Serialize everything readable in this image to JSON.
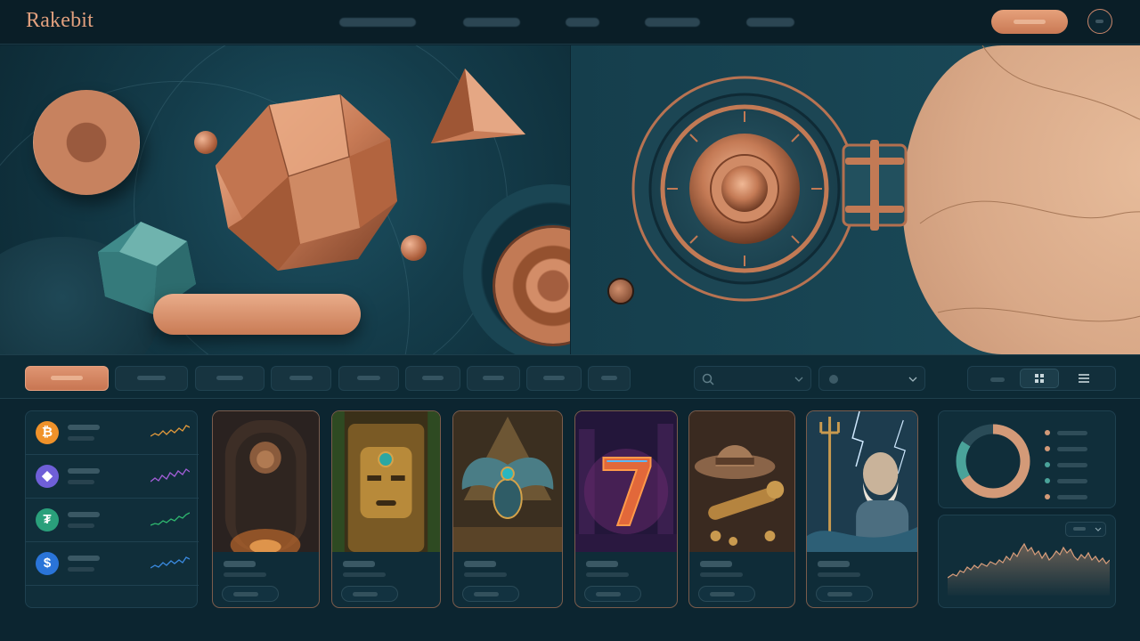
{
  "app": {
    "title": "Rakebit",
    "accent_color": "#d98a65",
    "background_color": "#0c2530"
  },
  "header": {
    "logo_text": "Rakebit",
    "nav_items": [
      "",
      "",
      "",
      "",
      ""
    ],
    "cta_label": "",
    "profile_icon": "user-icon"
  },
  "hero": {
    "left_banner_cta": "",
    "right_banner_theme": "vault-dial"
  },
  "filters": {
    "chips": [
      "",
      "",
      "",
      "",
      "",
      "",
      "",
      "",
      "",
      ""
    ],
    "active_chip_index": 0,
    "search_placeholder": "",
    "select_value": "",
    "view_modes": [
      "grid-icon",
      "list-icon"
    ],
    "active_view": "grid-icon"
  },
  "crypto_list": [
    {
      "symbol": "₿",
      "icon": "bitcoin-icon",
      "color": "#f0922a",
      "spark_color": "#e39a3b"
    },
    {
      "symbol": "◆",
      "icon": "ethereum-icon",
      "color": "#6f5fd8",
      "spark_color": "#a35ed8"
    },
    {
      "symbol": "₮",
      "icon": "tether-icon",
      "color": "#2aa07b",
      "spark_color": "#2fb86f"
    },
    {
      "symbol": "$",
      "icon": "usdc-icon",
      "color": "#2a74d8",
      "spark_color": "#3a8ae0"
    }
  ],
  "games": [
    {
      "art": "lion-gate-icon"
    },
    {
      "art": "aztec-mask-icon"
    },
    {
      "art": "scarab-icon"
    },
    {
      "art": "lucky-seven-icon"
    },
    {
      "art": "explorer-hat-icon"
    },
    {
      "art": "poseidon-icon"
    }
  ],
  "stats": {
    "donut_colors": [
      "#d39a78",
      "#4aa39a",
      "#2a4b57"
    ],
    "legend_colors": [
      "#d39a78",
      "#d39a78",
      "#4aa39a",
      "#4aa39a",
      "#d39a78"
    ],
    "range_select": ""
  }
}
